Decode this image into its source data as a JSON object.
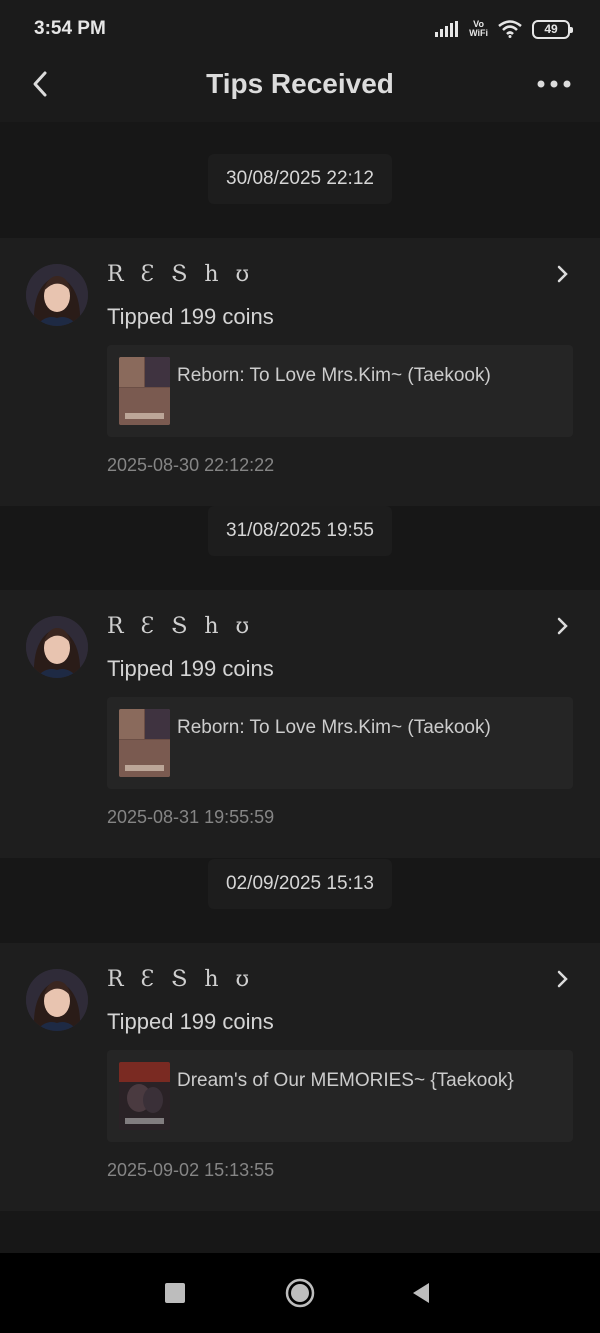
{
  "status": {
    "time": "3:54 PM",
    "volte_top": "Vo",
    "volte_bottom": "WiFi",
    "battery": "49"
  },
  "header": {
    "title": "Tips Received"
  },
  "entries": [
    {
      "date_chip": "30/08/2025 22:12",
      "username": "R Ɛ Տ h ʊ",
      "tip": "Tipped 199 coins",
      "book_title": "Reborn: To Love Mrs.Kim~ (Taekook)",
      "timestamp": "2025-08-30 22:12:22"
    },
    {
      "date_chip": "31/08/2025 19:55",
      "username": "R Ɛ Տ h ʊ",
      "tip": "Tipped 199 coins",
      "book_title": "Reborn: To Love Mrs.Kim~ (Taekook)",
      "timestamp": "2025-08-31 19:55:59"
    },
    {
      "date_chip": "02/09/2025 15:13",
      "username": "R Ɛ Տ h ʊ",
      "tip": "Tipped 199 coins",
      "book_title": "Dream's of Our MEMORIES~ {Taekook}",
      "timestamp": "2025-09-02 15:13:55"
    }
  ],
  "icons": {
    "back": "back-arrow-icon",
    "more": "more-dots-icon",
    "chevron": "chevron-right-icon",
    "nav_recents": "square-icon",
    "nav_home": "circle-icon",
    "nav_back": "triangle-back-icon"
  },
  "colors": {
    "background": "#171717",
    "card": "#1e1e1e",
    "book_box": "#252525"
  }
}
